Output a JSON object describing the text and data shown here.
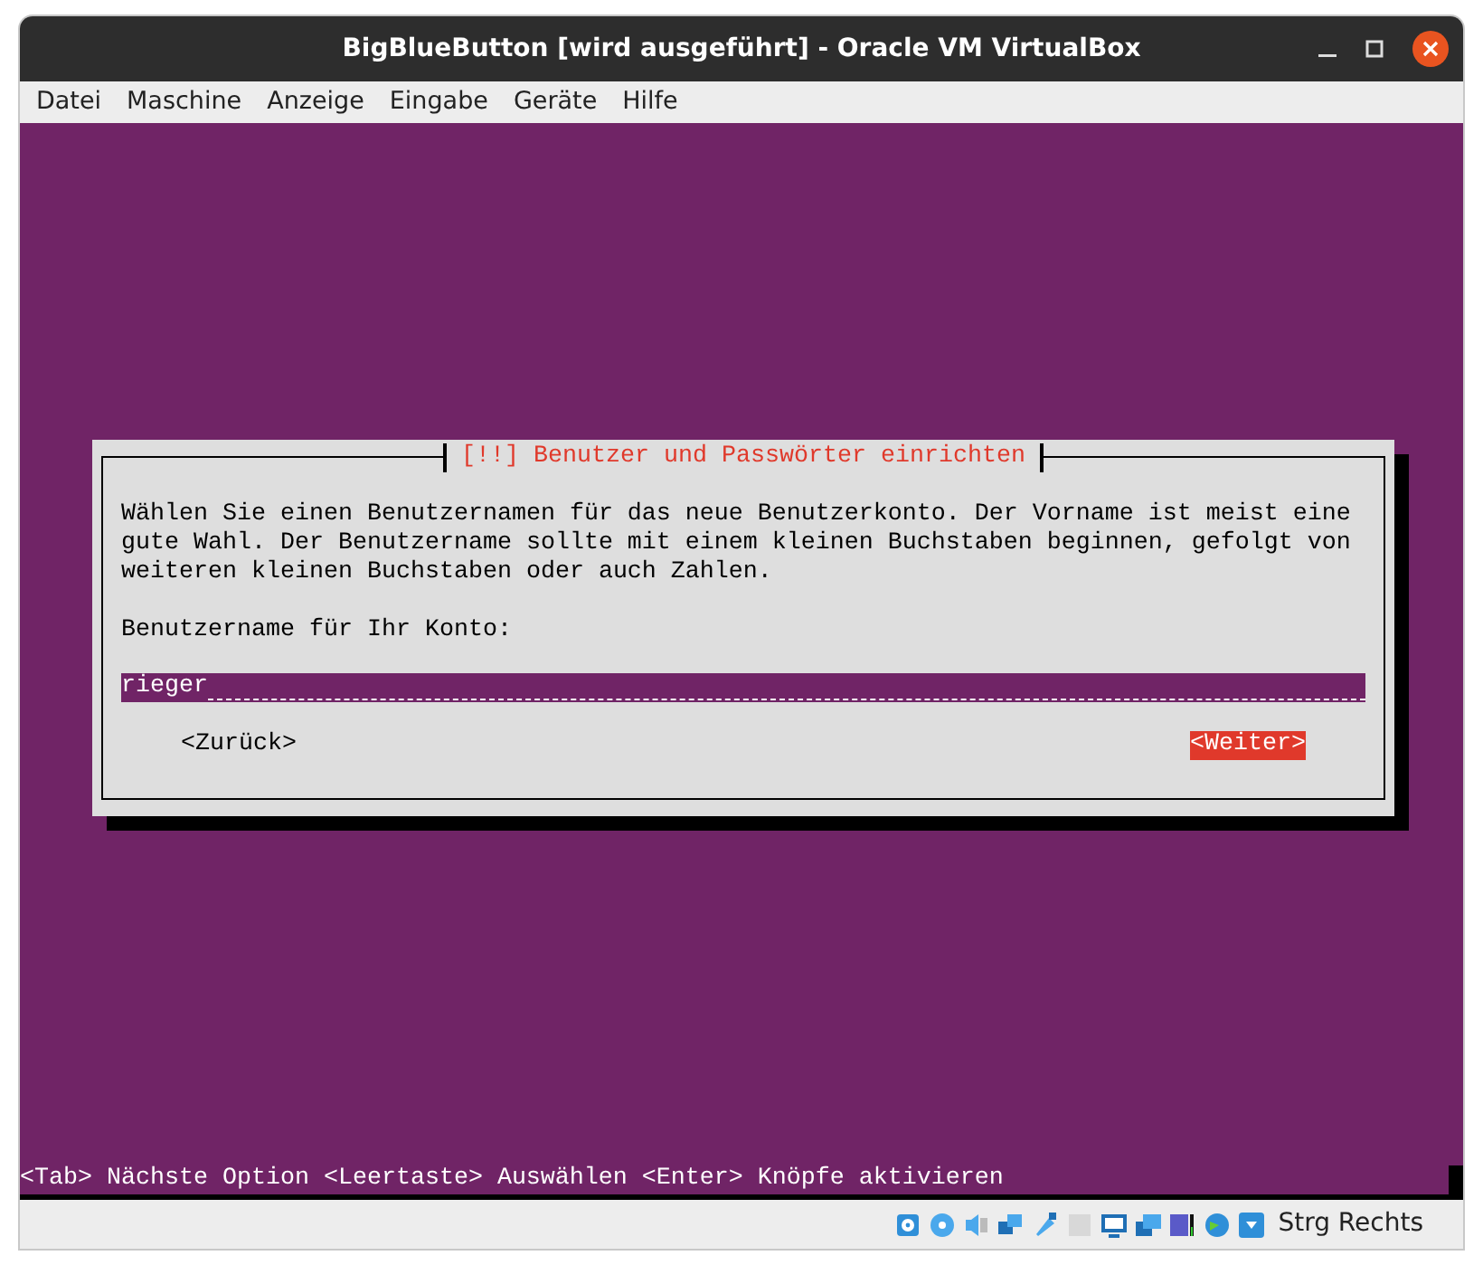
{
  "window": {
    "title": "BigBlueButton [wird ausgeführt] - Oracle VM VirtualBox"
  },
  "menu": [
    "Datei",
    "Maschine",
    "Anzeige",
    "Eingabe",
    "Geräte",
    "Hilfe"
  ],
  "dialog": {
    "title": "[!!] Benutzer und Passwörter einrichten",
    "text": "Wählen Sie einen Benutzernamen für das neue Benutzerkonto. Der Vorname ist meist eine gute Wahl. Der Benutzername sollte mit einem kleinen Buchstaben beginnen, gefolgt von weiteren kleinen Buchstaben oder auch Zahlen.",
    "field_label": "Benutzername für Ihr Konto:",
    "field_value": "rieger",
    "buttons": [
      {
        "label": "<Zurück>",
        "selected": false
      },
      {
        "label": "<Weiter>",
        "selected": true
      }
    ]
  },
  "hint": "<Tab> Nächste Option <Leertaste> Auswählen <Enter> Knöpfe aktivieren",
  "status_bar": {
    "host_key": "Strg Rechts"
  }
}
